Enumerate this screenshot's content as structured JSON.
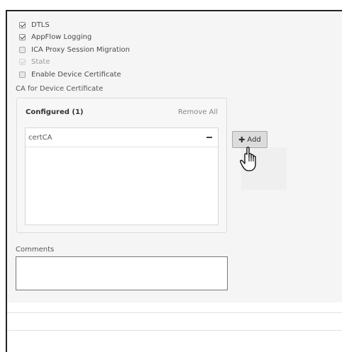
{
  "checkboxes": [
    {
      "label": "DTLS",
      "state": "checked"
    },
    {
      "label": "AppFlow Logging",
      "state": "checked"
    },
    {
      "label": "ICA Proxy Session Migration",
      "state": "unchecked"
    },
    {
      "label": "State",
      "state": "disabled-checked"
    },
    {
      "label": "Enable Device Certificate",
      "state": "unchecked"
    }
  ],
  "ca_section": {
    "label": "CA for Device Certificate",
    "configured_title": "Configured (1)",
    "remove_all": "Remove All",
    "items": [
      "certCA"
    ],
    "add_button": "Add"
  },
  "comments": {
    "label": "Comments",
    "value": ""
  },
  "icons": {
    "add": "plus-icon",
    "remove": "minus-icon",
    "cursor": "hand-pointer-icon"
  }
}
